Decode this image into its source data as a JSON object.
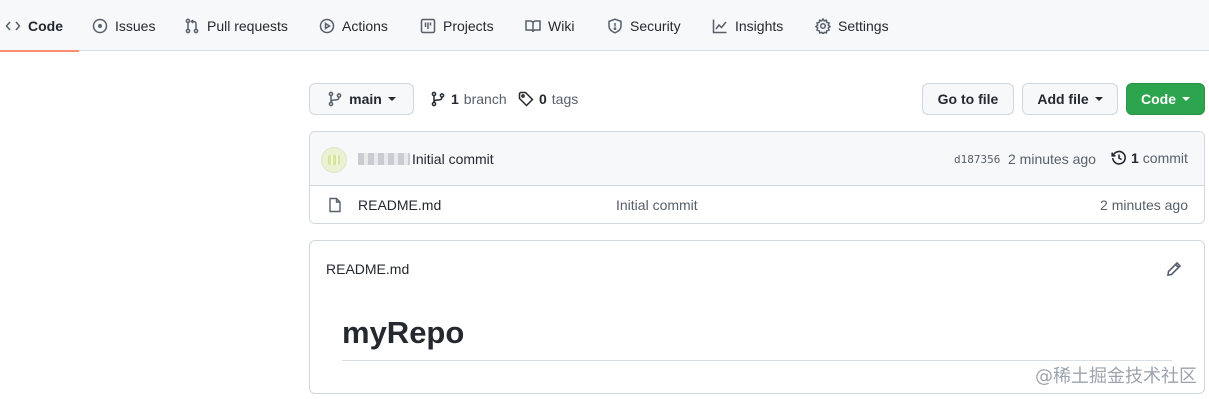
{
  "nav": {
    "tabs": [
      {
        "label": "Code",
        "icon": "code-icon",
        "selected": true
      },
      {
        "label": "Issues",
        "icon": "issue-icon"
      },
      {
        "label": "Pull requests",
        "icon": "pull-request-icon"
      },
      {
        "label": "Actions",
        "icon": "play-icon"
      },
      {
        "label": "Projects",
        "icon": "project-table-icon"
      },
      {
        "label": "Wiki",
        "icon": "book-icon"
      },
      {
        "label": "Security",
        "icon": "shield-icon"
      },
      {
        "label": "Insights",
        "icon": "graph-icon"
      },
      {
        "label": "Settings",
        "icon": "gear-icon"
      }
    ]
  },
  "toolbar": {
    "branch_select": "main",
    "branches_count": "1",
    "branches_label": "branch",
    "tags_count": "0",
    "tags_label": "tags",
    "go_to_file": "Go to file",
    "add_file": "Add file",
    "code": "Code"
  },
  "latest_commit": {
    "message": "Initial commit",
    "sha": "d187356",
    "time": "2 minutes ago",
    "commits_count": "1",
    "commits_label": "commit"
  },
  "files": [
    {
      "name": "README.md",
      "commit_message": "Initial commit",
      "time": "2 minutes ago"
    }
  ],
  "readme": {
    "title": "README.md",
    "heading": "myRepo"
  },
  "watermark": "@稀土掘金技术社区",
  "colors": {
    "accent_underline": "#fd8c73",
    "primary_button": "#2da44e"
  }
}
